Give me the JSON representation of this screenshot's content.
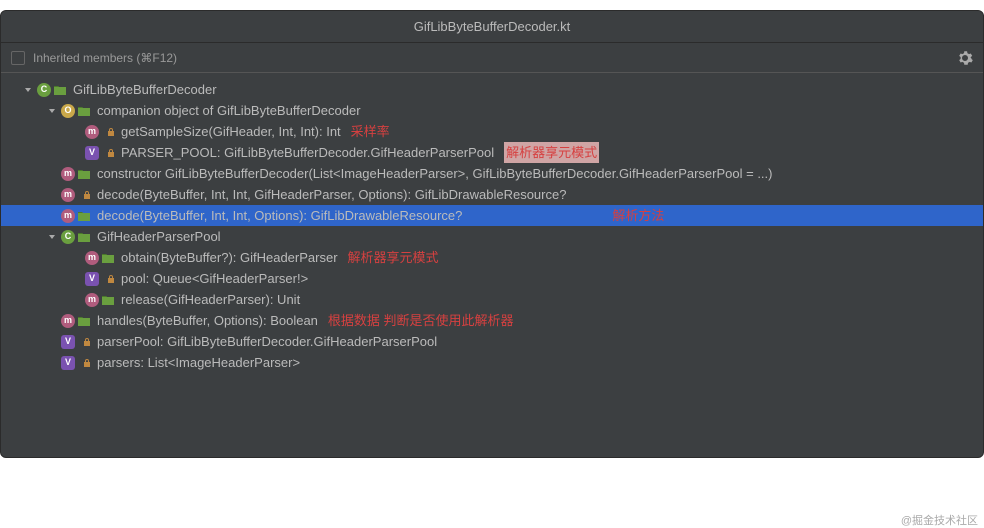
{
  "title": "GifLibByteBufferDecoder.kt",
  "toolbar": {
    "inherited_label": "Inherited members (⌘F12)"
  },
  "tree": [
    {
      "ind": 0,
      "chev": "down",
      "badges": [
        "c"
      ],
      "folder": true,
      "lock": false,
      "text": "GifLibByteBufferDecoder",
      "anno": "",
      "inter": true
    },
    {
      "ind": 1,
      "chev": "down",
      "badges": [
        "o"
      ],
      "folder": true,
      "lock": false,
      "text": "companion object of GifLibByteBufferDecoder",
      "anno": "",
      "inter": true
    },
    {
      "ind": 2,
      "chev": "",
      "badges": [
        "m"
      ],
      "folder": false,
      "lock": true,
      "text": "getSampleSize(GifHeader, Int, Int): Int",
      "anno": "采样率",
      "inter": true
    },
    {
      "ind": 2,
      "chev": "",
      "badges": [
        "v"
      ],
      "folder": false,
      "lock": true,
      "text": "PARSER_POOL: GifLibByteBufferDecoder.GifHeaderParserPool",
      "anno": "解析器享元模式",
      "anno_hl": true,
      "inter": true
    },
    {
      "ind": 1,
      "chev": "",
      "badges": [
        "m"
      ],
      "folder": true,
      "lock": false,
      "text": "constructor GifLibByteBufferDecoder(List<ImageHeaderParser>, GifLibByteBufferDecoder.GifHeaderParserPool = ...)",
      "anno": "",
      "inter": true
    },
    {
      "ind": 1,
      "chev": "",
      "badges": [
        "m"
      ],
      "folder": false,
      "lock": true,
      "text": "decode(ByteBuffer, Int, Int, GifHeaderParser, Options): GifLibDrawableResource?",
      "anno": "",
      "inter": true
    },
    {
      "ind": 1,
      "chev": "",
      "badges": [
        "m"
      ],
      "folder": true,
      "lock": false,
      "text": "decode(ByteBuffer, Int, Int, Options): GifLibDrawableResource?",
      "anno": "解析方法",
      "selected": true,
      "anno_far": true,
      "inter": true
    },
    {
      "ind": 1,
      "chev": "down",
      "badges": [
        "c"
      ],
      "folder": true,
      "lock": false,
      "text": "GifHeaderParserPool",
      "anno": "",
      "inter": true
    },
    {
      "ind": 2,
      "chev": "",
      "badges": [
        "m"
      ],
      "folder": true,
      "lock": false,
      "text": "obtain(ByteBuffer?): GifHeaderParser",
      "anno": "解析器享元模式",
      "inter": true
    },
    {
      "ind": 2,
      "chev": "",
      "badges": [
        "v"
      ],
      "folder": false,
      "lock": true,
      "text": "pool: Queue<GifHeaderParser!>",
      "anno": "",
      "inter": true
    },
    {
      "ind": 2,
      "chev": "",
      "badges": [
        "m"
      ],
      "folder": true,
      "lock": false,
      "text": "release(GifHeaderParser): Unit",
      "anno": "",
      "inter": true
    },
    {
      "ind": 1,
      "chev": "",
      "badges": [
        "m"
      ],
      "folder": true,
      "lock": false,
      "text": "handles(ByteBuffer, Options): Boolean",
      "anno": "根据数据 判断是否使用此解析器",
      "inter": true
    },
    {
      "ind": 1,
      "chev": "",
      "badges": [
        "v"
      ],
      "folder": false,
      "lock": true,
      "text": "parserPool: GifLibByteBufferDecoder.GifHeaderParserPool",
      "anno": "",
      "inter": true
    },
    {
      "ind": 1,
      "chev": "",
      "badges": [
        "v"
      ],
      "folder": false,
      "lock": true,
      "text": "parsers: List<ImageHeaderParser>",
      "anno": "",
      "inter": true
    }
  ],
  "watermark": "@掘金技术社区"
}
